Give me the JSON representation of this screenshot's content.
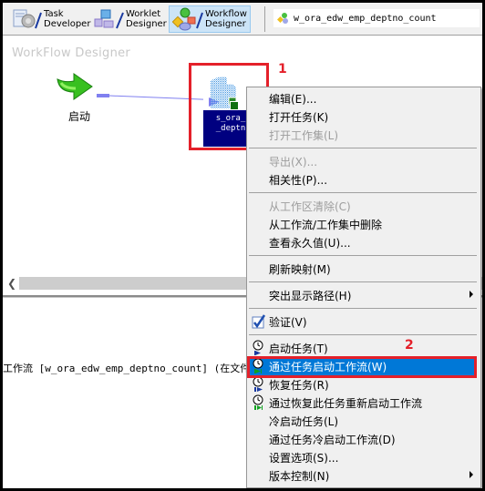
{
  "toolbar": {
    "buttons": [
      {
        "line1": "Task",
        "line2": "Developer",
        "icon": "task-developer-icon",
        "active": false
      },
      {
        "line1": "Worklet",
        "line2": "Designer",
        "icon": "worklet-designer-icon",
        "active": false
      },
      {
        "line1": "Workflow",
        "line2": "Designer",
        "icon": "workflow-designer-icon",
        "active": true
      }
    ],
    "workflow_name": "w_ora_edw_emp_deptno_count"
  },
  "canvas": {
    "title": "WorkFlow Designer",
    "start_node_label": "启动",
    "session_line1": "s_ora_",
    "session_line2": "_deptn"
  },
  "annotations": {
    "marker1": "1",
    "marker2": "2",
    "color": "#e4202a"
  },
  "output": {
    "line": "工作流 [w_ora_edw_emp_deptno_count] (在文件夹"
  },
  "context_menu": {
    "items": [
      {
        "label": "编辑(E)...",
        "disabled": false
      },
      {
        "label": "打开任务(K)",
        "disabled": false
      },
      {
        "label": "打开工作集(L)",
        "disabled": true
      },
      {
        "label": "导出(X)...",
        "disabled": true
      },
      {
        "label": "相关性(P)...",
        "disabled": false
      },
      {
        "label": "从工作区清除(C)",
        "disabled": true
      },
      {
        "label": "从工作流/工作集中删除",
        "disabled": false
      },
      {
        "label": "查看永久值(U)...",
        "disabled": false
      },
      {
        "label": "刷新映射(M)",
        "disabled": false
      },
      {
        "label": "突出显示路径(H)",
        "disabled": false,
        "submenu": true
      },
      {
        "label": "验证(V)",
        "disabled": false,
        "icon": "validate-check-icon"
      },
      {
        "label": "启动任务(T)",
        "disabled": false,
        "icon": "start-task-icon"
      },
      {
        "label": "通过任务启动工作流(W)",
        "disabled": false,
        "icon": "start-workflow-from-task-icon",
        "selected": true
      },
      {
        "label": "恢复任务(R)",
        "disabled": false,
        "icon": "recover-task-icon"
      },
      {
        "label": "通过恢复此任务重新启动工作流",
        "disabled": false,
        "icon": "restart-workflow-recover-icon"
      },
      {
        "label": "冷启动任务(L)",
        "disabled": false
      },
      {
        "label": "通过任务冷启动工作流(D)",
        "disabled": false
      },
      {
        "label": "设置选项(S)...",
        "disabled": false
      },
      {
        "label": "版本控制(N)",
        "disabled": false,
        "submenu": true
      }
    ],
    "selected_color": "#0078d7"
  }
}
